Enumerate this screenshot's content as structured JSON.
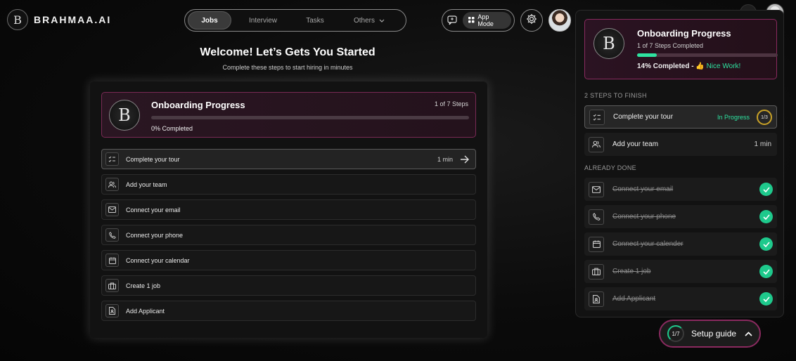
{
  "brand": {
    "mark": "B",
    "name": "BRAHMAA.AI"
  },
  "nav": {
    "tabs": [
      {
        "label": "Jobs",
        "active": true
      },
      {
        "label": "Interview",
        "active": false
      },
      {
        "label": "Tasks",
        "active": false
      },
      {
        "label": "Others",
        "active": false
      }
    ],
    "app_mode_label": "App Mode"
  },
  "welcome": {
    "title": "Welcome! Let’s Gets You Started",
    "subtitle": "Complete these steps to start hiring in minutes"
  },
  "onboarding": {
    "title": "Onboarding Progress",
    "steps_count": "1 of 7 Steps",
    "progress": 0,
    "percent_label": "0% Completed",
    "steps": [
      {
        "label": "Complete your tour",
        "time": "1 min",
        "icon": "checklist-icon",
        "active": true
      },
      {
        "label": "Add your team",
        "icon": "users-icon"
      },
      {
        "label": "Connect your email",
        "icon": "mail-icon"
      },
      {
        "label": "Connect your phone",
        "icon": "phone-icon"
      },
      {
        "label": "Connect your calendar",
        "icon": "calendar-icon"
      },
      {
        "label": "Create 1 job",
        "icon": "briefcase-icon"
      },
      {
        "label": "Add Applicant",
        "icon": "document-icon"
      }
    ]
  },
  "panel": {
    "title": "Onboarding Progress",
    "subtitle": "1 of 7 Steps Completed",
    "progress": 0.14,
    "percent_label": "14% Completed - ",
    "nice_label": "👍 Nice Work!",
    "to_finish_label": "2 STEPS TO FINISH",
    "to_finish": [
      {
        "label": "Complete your tour",
        "status": "In Progress",
        "ring": "1/3",
        "icon": "checklist-icon"
      },
      {
        "label": "Add your team",
        "time": "1 min",
        "icon": "users-icon"
      }
    ],
    "done_label": "ALREADY DONE",
    "done": [
      {
        "label": "Connect your email",
        "icon": "mail-icon"
      },
      {
        "label": "Connect your phone",
        "icon": "phone-icon"
      },
      {
        "label": "Connect your calender",
        "icon": "calendar-icon"
      },
      {
        "label": "Create 1 job",
        "icon": "briefcase-icon"
      },
      {
        "label": "Add Applicant",
        "icon": "document-icon"
      }
    ]
  },
  "setup_guide": {
    "ring": "1/7",
    "label": "Setup guide"
  },
  "colors": {
    "accent": "#2ee3a0",
    "magenta": "#8a2a5f",
    "gold": "#c9a227"
  }
}
